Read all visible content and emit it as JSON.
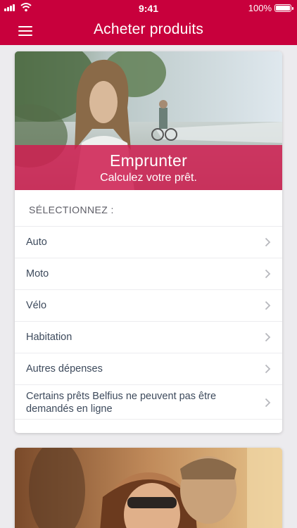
{
  "status_bar": {
    "time": "9:41",
    "battery": "100%"
  },
  "nav": {
    "title": "Acheter produits"
  },
  "loan_card": {
    "title": "Emprunter",
    "subtitle": "Calculez votre prêt.",
    "section_label": "SÉLECTIONNEZ :",
    "items": [
      {
        "label": "Auto"
      },
      {
        "label": "Moto"
      },
      {
        "label": "Vélo"
      },
      {
        "label": "Habitation"
      },
      {
        "label": "Autres dépenses"
      },
      {
        "label": "Certains prêts Belfius ne peuvent pas être demandés en ligne"
      }
    ]
  },
  "colors": {
    "brand": "#c8003c",
    "band": "#ce1e50",
    "text": "#3d4a5c",
    "background": "#ecebee"
  }
}
